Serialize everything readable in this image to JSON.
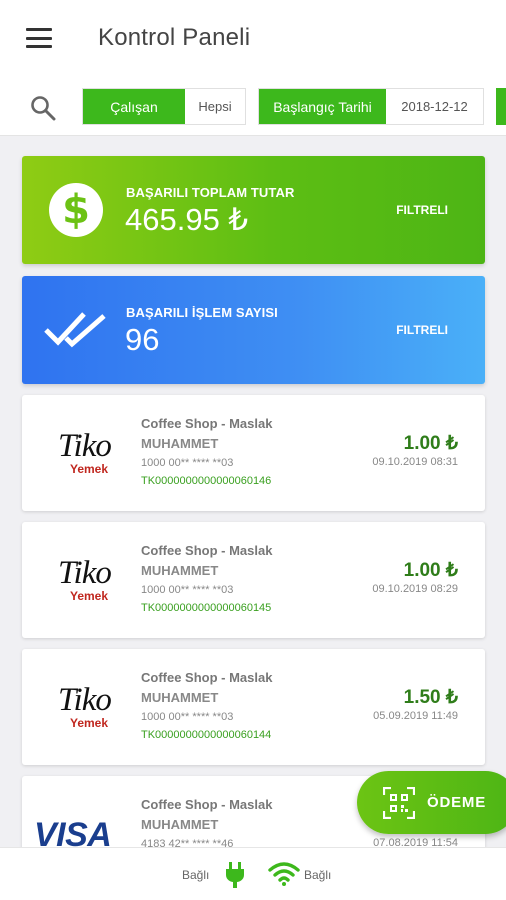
{
  "appbar": {
    "title": "Kontrol Paneli"
  },
  "filters": {
    "employee_label": "Çalışan",
    "employee_value": "Hepsi",
    "start_label": "Başlangıç Tarihi",
    "start_value": "2018-12-12"
  },
  "summary": {
    "total": {
      "label": "BAŞARILI TOPLAM TUTAR",
      "value": "465.95 ₺",
      "filter": "FILTRELI"
    },
    "count": {
      "label": "BAŞARILI İŞLEM SAYISI",
      "value": "96",
      "filter": "FILTRELI"
    }
  },
  "transactions": [
    {
      "logo": "tiko-yemek-logo",
      "logo_main": "Tiko",
      "logo_sub": "Yemek",
      "merchant": "Coffee Shop - Maslak",
      "user": "MUHAMMET",
      "card": "1000 00** **** **03",
      "ref": "TK0000000000000060146",
      "amount": "1.00 ₺",
      "date": "09.10.2019 08:31"
    },
    {
      "logo": "tiko-yemek-logo",
      "logo_main": "Tiko",
      "logo_sub": "Yemek",
      "merchant": "Coffee Shop - Maslak",
      "user": "MUHAMMET",
      "card": "1000 00** **** **03",
      "ref": "TK0000000000000060145",
      "amount": "1.00 ₺",
      "date": "09.10.2019 08:29"
    },
    {
      "logo": "tiko-yemek-logo",
      "logo_main": "Tiko",
      "logo_sub": "Yemek",
      "merchant": "Coffee Shop - Maslak",
      "user": "MUHAMMET",
      "card": "1000 00** **** **03",
      "ref": "TK0000000000000060144",
      "amount": "1.50 ₺",
      "date": "05.09.2019 11:49"
    },
    {
      "logo": "visa-logo",
      "logo_main": "VISA",
      "merchant": "Coffee Shop - Maslak",
      "user": "MUHAMMET",
      "card": "4183 42** **** **46",
      "date": "07.08.2019 11:54"
    }
  ],
  "fab": {
    "label": "ÖDEME"
  },
  "statusbar": {
    "power_status": "Bağlı",
    "wifi_status": "Bağlı"
  },
  "colors": {
    "accent_green": "#3db81c",
    "amount_green": "#2f7d1a",
    "blue": "#3f8ff3"
  }
}
